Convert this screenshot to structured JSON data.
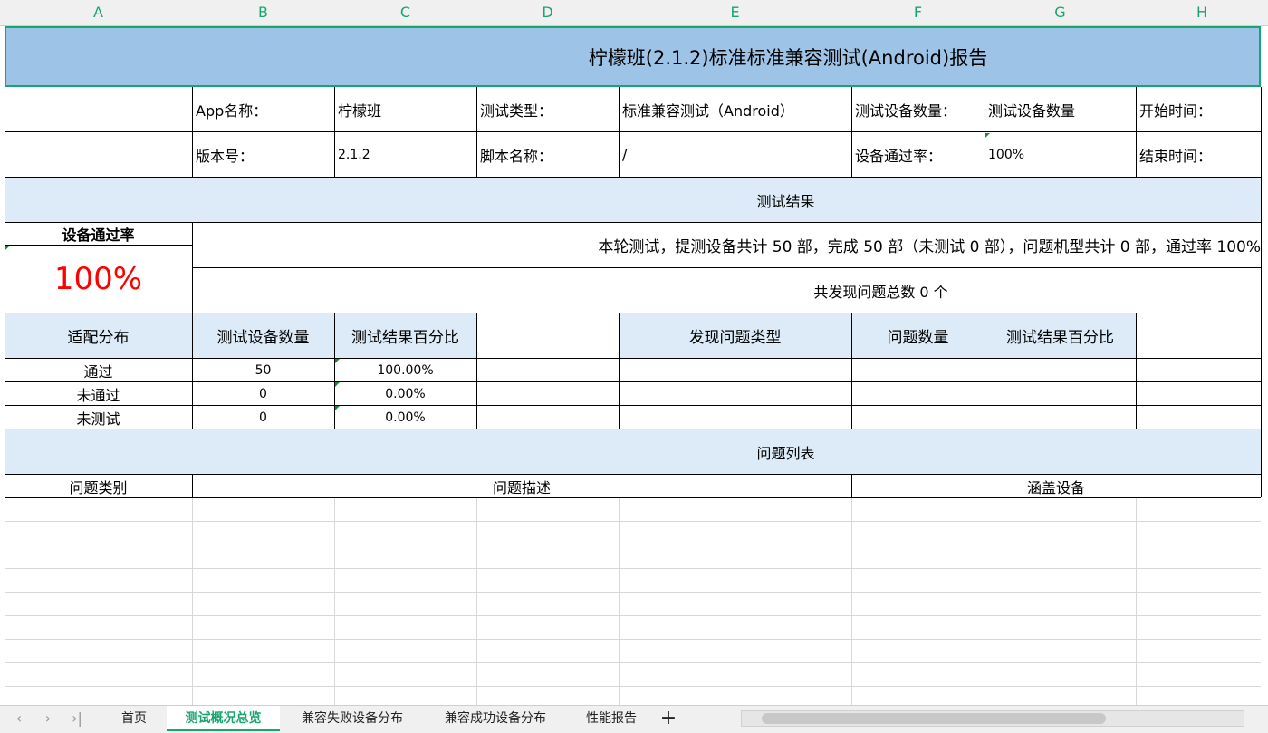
{
  "columns": [
    "A",
    "B",
    "C",
    "D",
    "E",
    "F",
    "G",
    "H"
  ],
  "title": "柠檬班(2.1.2)标准标准兼容测试(Android)报告",
  "info_row1": {
    "app_label": "App名称：",
    "app_value": "柠檬班",
    "type_label": "测试类型：",
    "type_value": "标准兼容测试（Android）",
    "count_label": "测试设备数量：",
    "count_value": "测试设备数量",
    "start_label": "开始时间："
  },
  "info_row2": {
    "version_label": "版本号：",
    "version_value": "2.1.2",
    "script_label": "脚本名称：",
    "script_value": "/",
    "pass_label": "设备通过率：",
    "pass_value": "100%",
    "end_label": "结束时间："
  },
  "results_header": "测试结果",
  "pass_rate": {
    "label": "设备通过率",
    "value": "100%",
    "color": "#ff0000"
  },
  "summary": "本轮测试，提测设备共计 50 部，完成 50 部（未测试 0 部），问题机型共计 0 部，通过率 100%",
  "issues_total": "共发现问题总数 0 个",
  "dist_headers": [
    "适配分布",
    "测试设备数量",
    "测试结果百分比",
    "",
    "发现问题类型",
    "问题数量",
    "测试结果百分比"
  ],
  "dist_rows": [
    {
      "label": "通过",
      "count": "50",
      "percent": "100.00%"
    },
    {
      "label": "未通过",
      "count": "0",
      "percent": "0.00%"
    },
    {
      "label": "未测试",
      "count": "0",
      "percent": "0.00%"
    }
  ],
  "issue_list_header": "问题列表",
  "issue_list_columns": {
    "category": "问题类别",
    "description": "问题描述",
    "devices": "涵盖设备"
  },
  "sheet_tabs": [
    "首页",
    "测试概况总览",
    "兼容失败设备分布",
    "兼容成功设备分布",
    "性能报告"
  ],
  "active_tab": "测试概况总览",
  "add_sheet": "+",
  "colors": {
    "title_bg": "#9dc3e6",
    "section_bg": "#dcebf7",
    "accent": "#1aa56e"
  }
}
